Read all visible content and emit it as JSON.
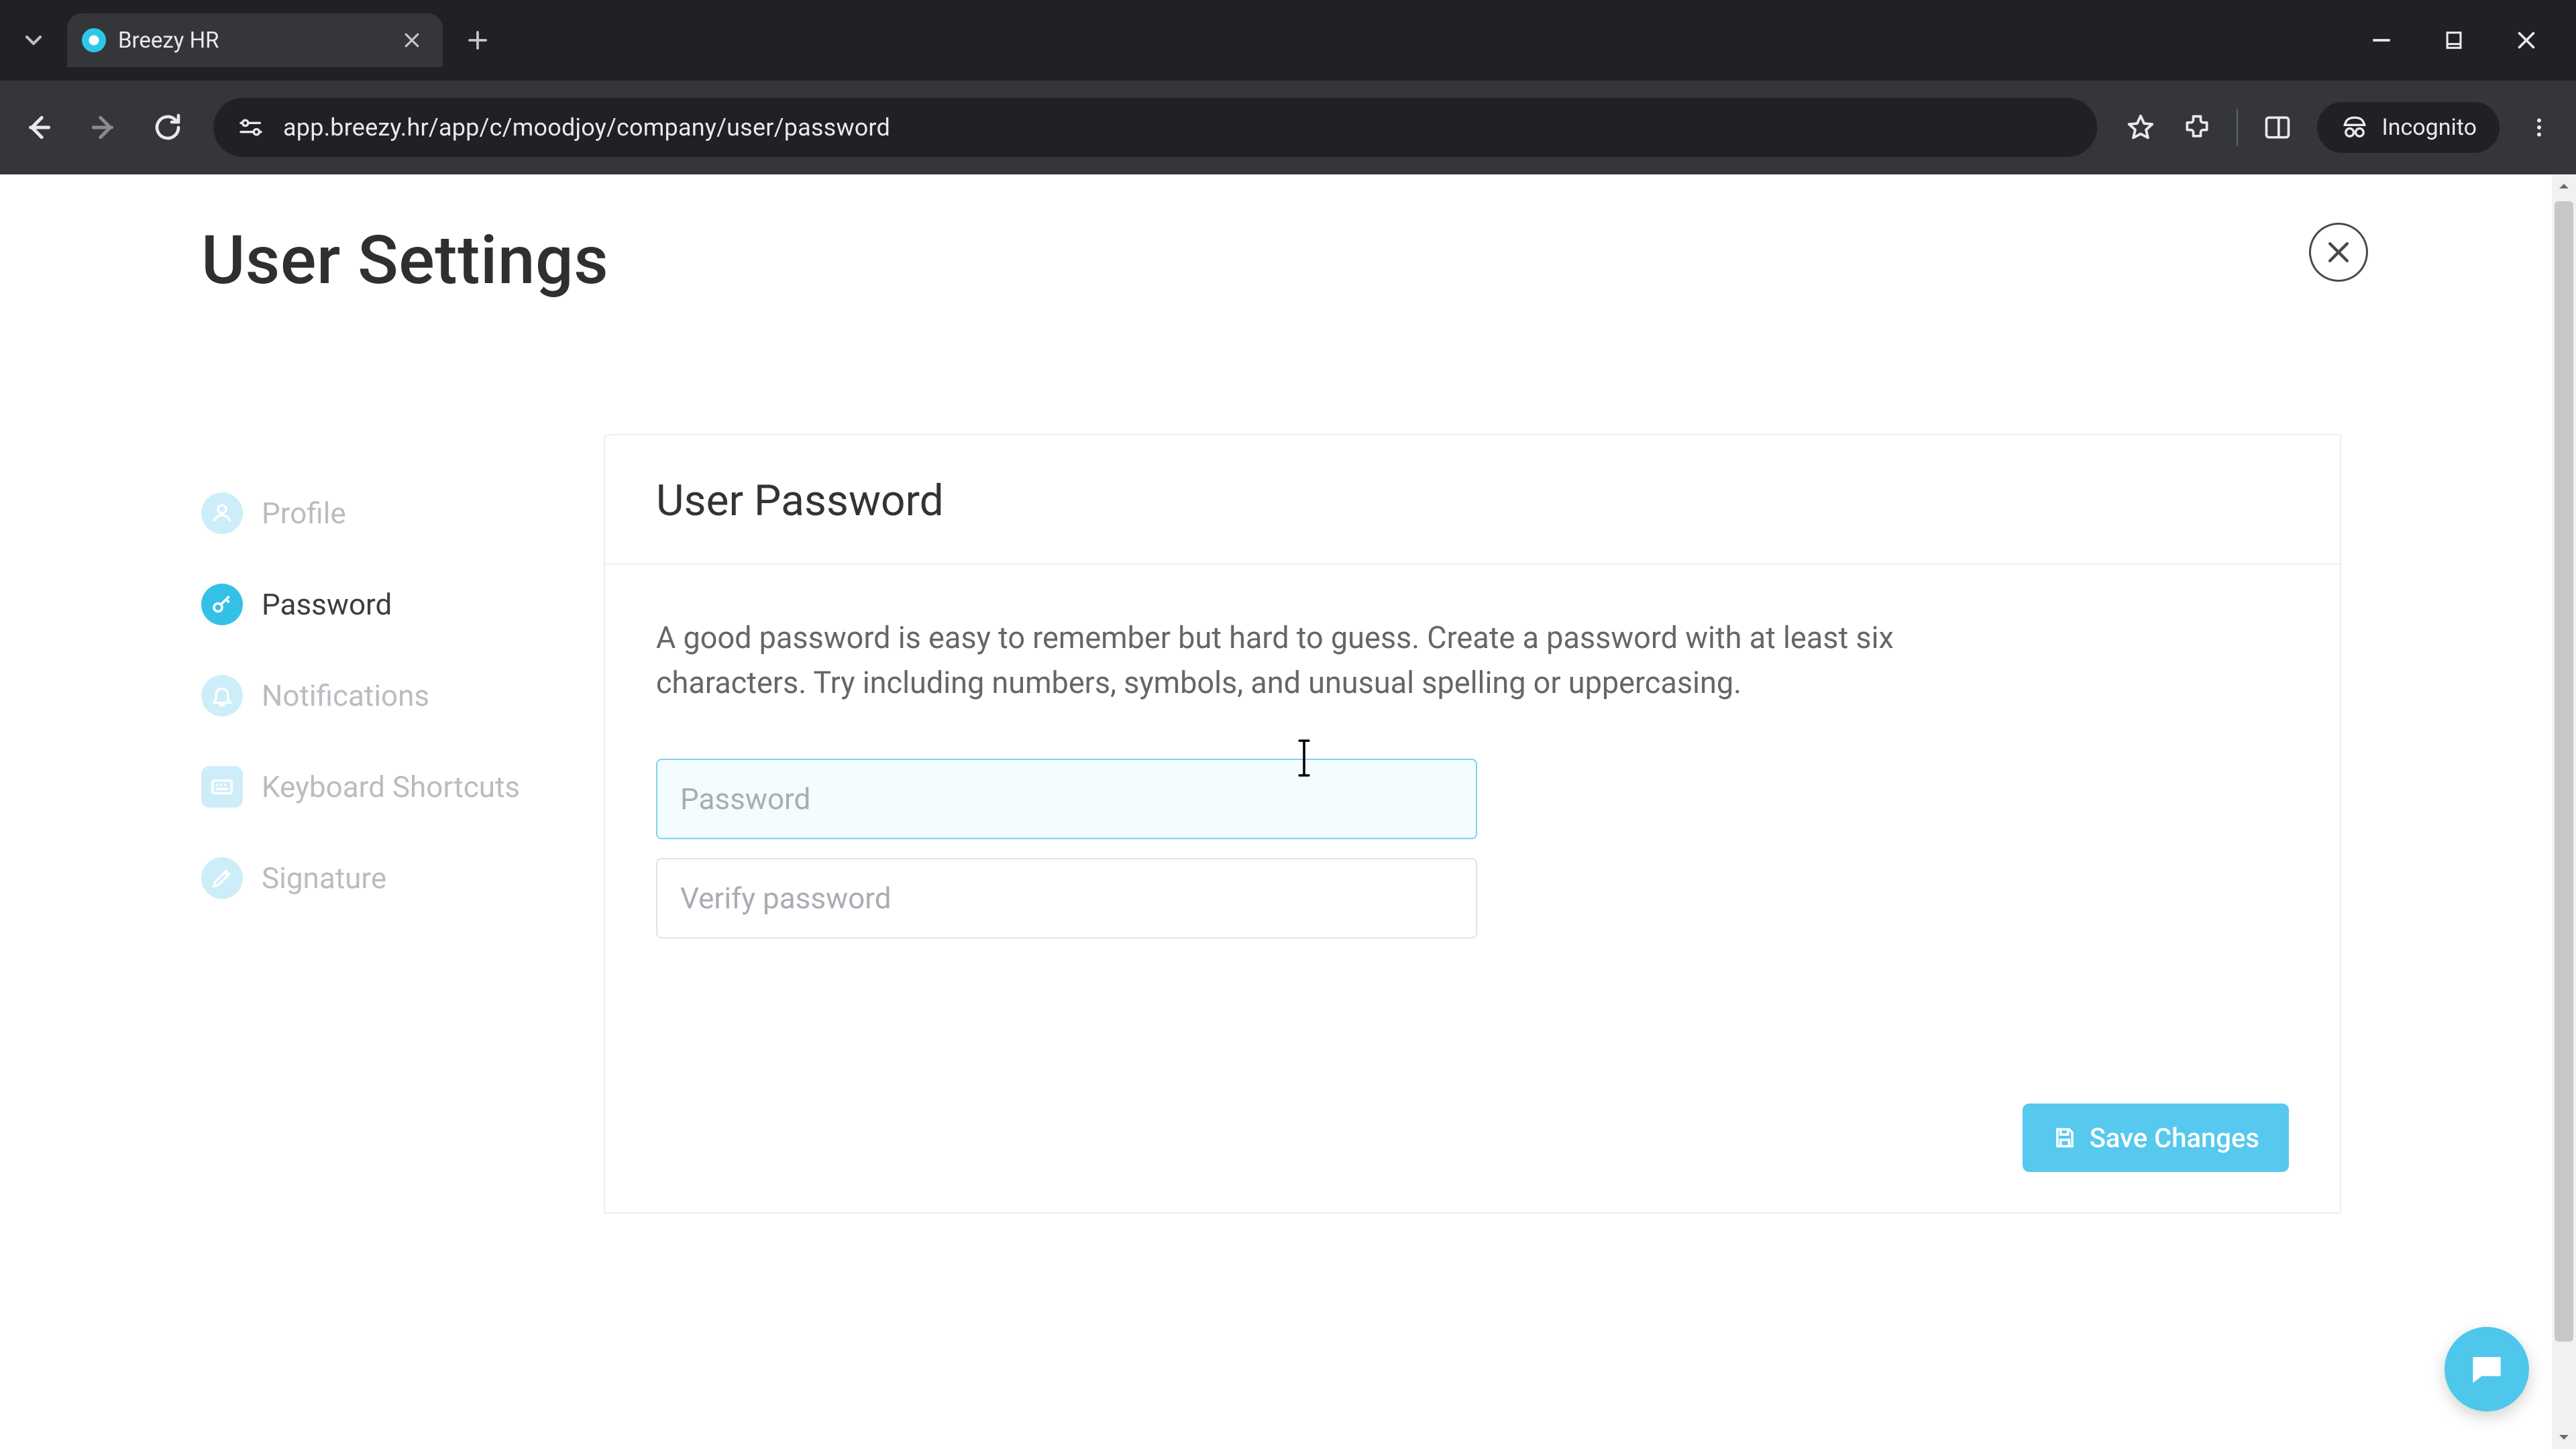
{
  "browser": {
    "tab_title": "Breezy HR",
    "url": "app.breezy.hr/app/c/moodjoy/company/user/password",
    "incognito_label": "Incognito"
  },
  "page": {
    "title": "User Settings"
  },
  "sidebar": {
    "items": [
      {
        "label": "Profile"
      },
      {
        "label": "Password"
      },
      {
        "label": "Notifications"
      },
      {
        "label": "Keyboard Shortcuts"
      },
      {
        "label": "Signature"
      }
    ]
  },
  "card": {
    "title": "User Password",
    "hint": "A good password is easy to remember but hard to guess. Create a password with at least six characters. Try including numbers, symbols, and unusual spelling or uppercasing.",
    "password_placeholder": "Password",
    "verify_placeholder": "Verify password",
    "save_label": "Save Changes"
  }
}
